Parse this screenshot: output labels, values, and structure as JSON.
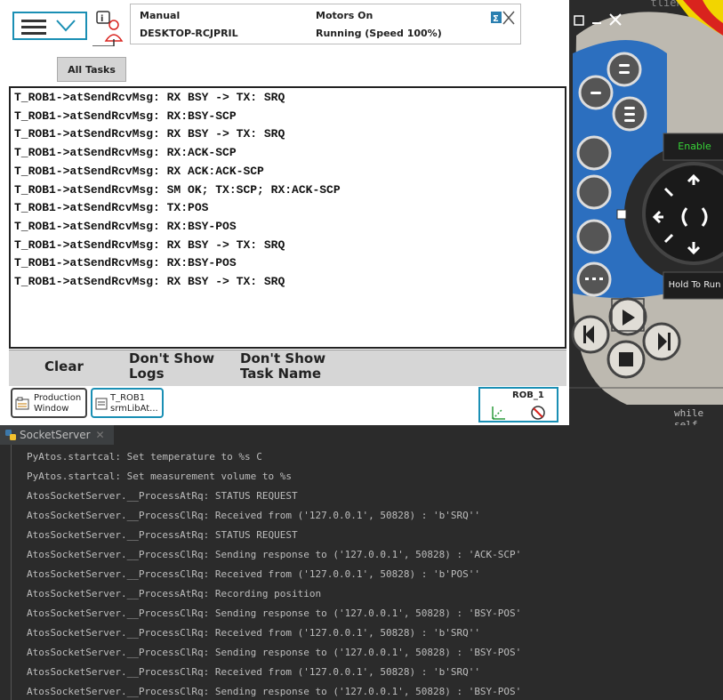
{
  "status": {
    "mode": "Manual",
    "controller": "DESKTOP-RCJPRIL",
    "motors": "Motors On",
    "run_state": "Running (Speed 100%)"
  },
  "tabs": {
    "all_tasks": "All Tasks"
  },
  "log": {
    "lines": [
      "T_ROB1->atSendRcvMsg: RX BSY -> TX: SRQ",
      "T_ROB1->atSendRcvMsg: RX:BSY-SCP",
      "T_ROB1->atSendRcvMsg: RX BSY -> TX: SRQ",
      "T_ROB1->atSendRcvMsg: RX:ACK-SCP",
      "T_ROB1->atSendRcvMsg: RX ACK:ACK-SCP",
      "T_ROB1->atSendRcvMsg: SM OK; TX:SCP; RX:ACK-SCP",
      "T_ROB1->atSendRcvMsg: TX:POS",
      "T_ROB1->atSendRcvMsg: RX:BSY-POS",
      "T_ROB1->atSendRcvMsg: RX BSY -> TX: SRQ",
      "T_ROB1->atSendRcvMsg: RX:BSY-POS",
      "T_ROB1->atSendRcvMsg: RX BSY -> TX: SRQ"
    ]
  },
  "buttons": {
    "clear": "Clear",
    "dont_show_logs_1": "Don't Show",
    "dont_show_logs_2": "Logs",
    "dont_show_task_1": "Don't Show",
    "dont_show_task_2": "Task Name"
  },
  "taskbar": {
    "production_1": "Production",
    "production_2": "Window",
    "task_1": "T_ROB1",
    "task_2": "srmLibAt...",
    "robot": "ROB_1"
  },
  "joystick_panel": {
    "enable": "Enable",
    "hold_to_run": "Hold To Run",
    "code_top": "tlientLock.",
    "code_bottom": "while self."
  },
  "ide": {
    "tab_title": "SocketServer",
    "lines": [
      "PyAtos.startcal: Set temperature to %s C",
      "PyAtos.startcal: Set measurement volume to %s",
      "AtosSocketServer.__ProcessAtRq: STATUS REQUEST",
      "AtosSocketServer.__ProcessClRq: Received from ('127.0.0.1', 50828) : 'b'SRQ''",
      "AtosSocketServer.__ProcessAtRq: STATUS REQUEST",
      "AtosSocketServer.__ProcessClRq: Sending response to ('127.0.0.1', 50828) : 'ACK-SCP'",
      "AtosSocketServer.__ProcessClRq: Received from ('127.0.0.1', 50828) : 'b'POS''",
      "AtosSocketServer.__ProcessAtRq: Recording position",
      "AtosSocketServer.__ProcessClRq: Sending response to ('127.0.0.1', 50828) : 'BSY-POS'",
      "AtosSocketServer.__ProcessClRq: Received from ('127.0.0.1', 50828) : 'b'SRQ''",
      "AtosSocketServer.__ProcessClRq: Sending response to ('127.0.0.1', 50828) : 'BSY-POS'",
      "AtosSocketServer.__ProcessClRq: Received from ('127.0.0.1', 50828) : 'b'SRQ''",
      "AtosSocketServer.__ProcessClRq: Sending response to ('127.0.0.1', 50828) : 'BSY-POS'"
    ]
  },
  "colors": {
    "accent": "#1a8fb4",
    "joystick_blue": "#2c6fbf",
    "enable_green": "#37d437",
    "warning_red": "#d9231e",
    "yellow": "#f2d500"
  }
}
